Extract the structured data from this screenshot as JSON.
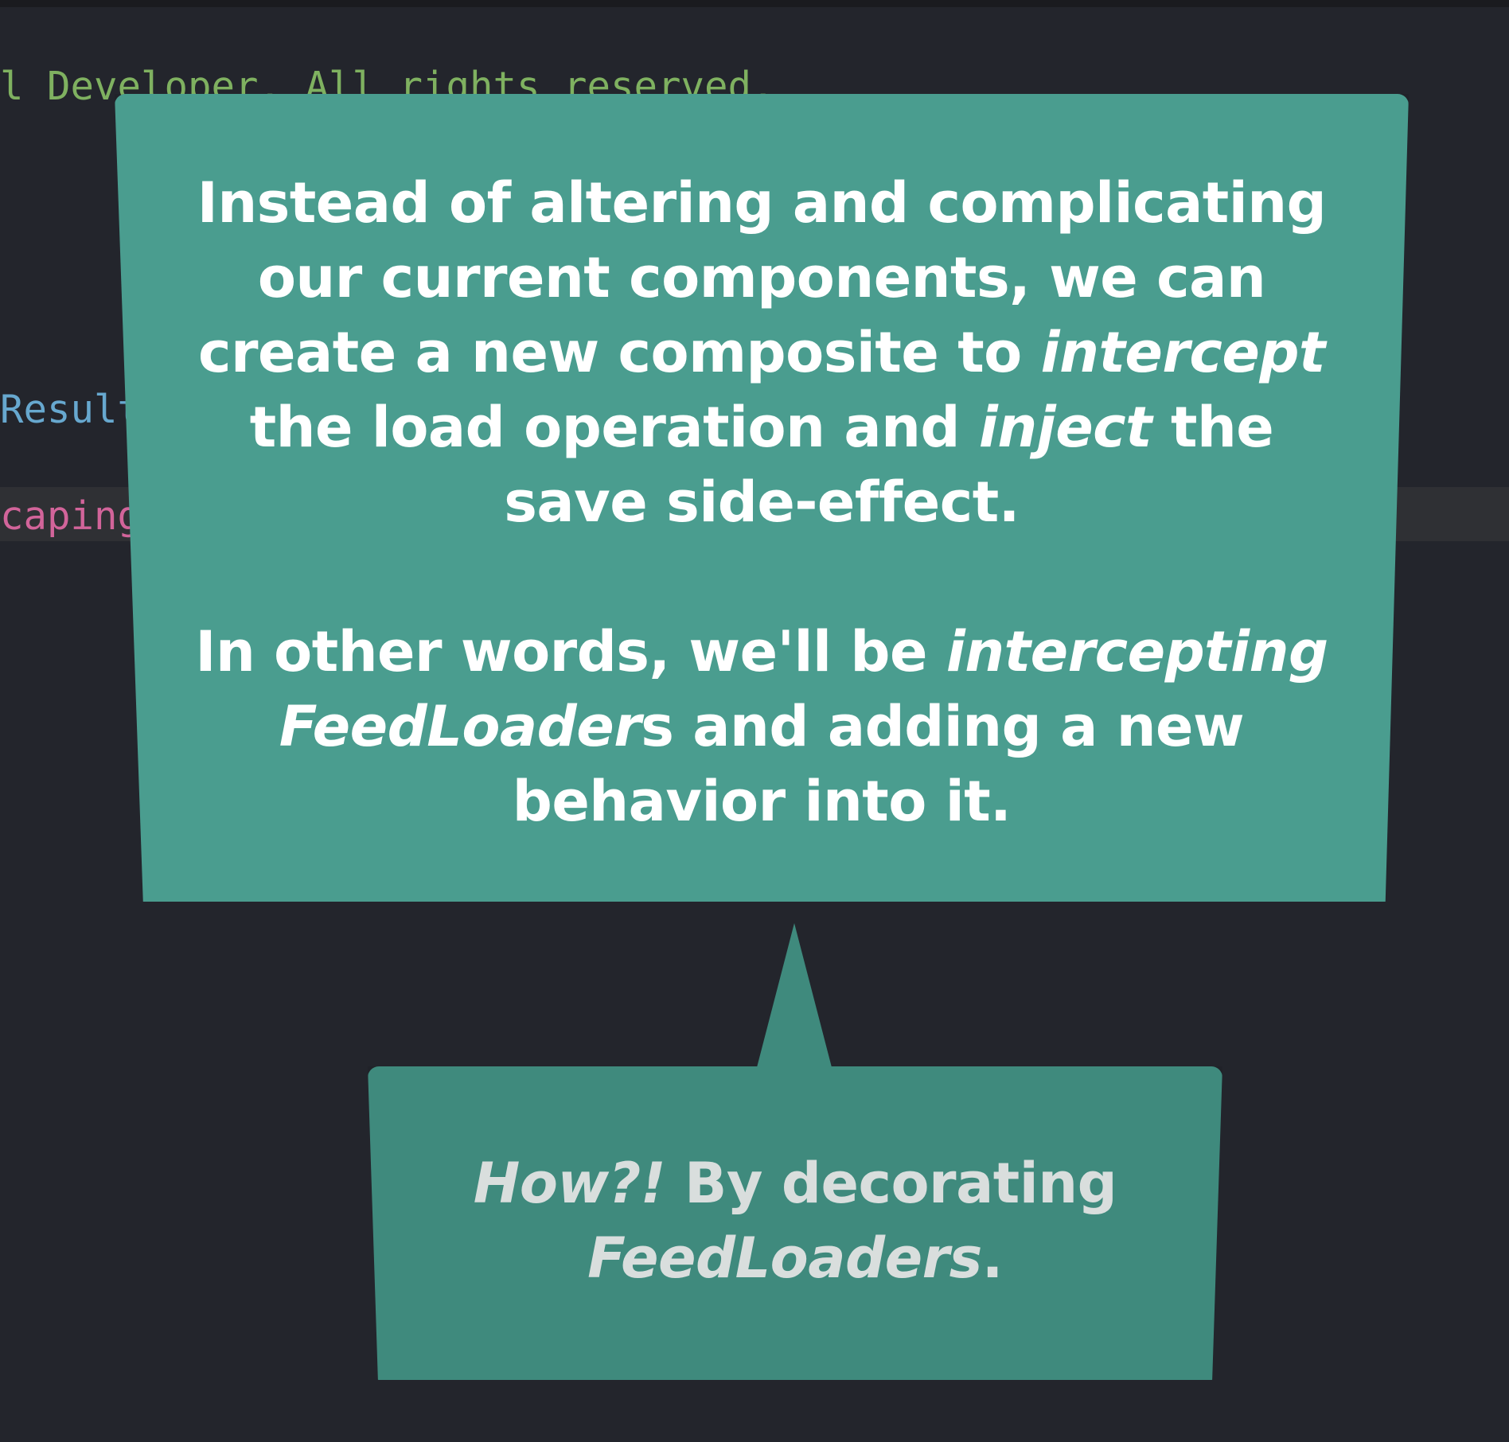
{
  "background": {
    "code_comment": "l Developer. All rights reserved.",
    "code_type": "Result",
    "code_keyword": "caping"
  },
  "main_card": {
    "p1": {
      "line1": "Instead of altering and complicating",
      "line2": "our current components, we can",
      "line3_pre": "create a new composite to ",
      "line3_em": "intercept",
      "line4_pre": "the load operation and ",
      "line4_em": "inject",
      "line4_post": " the",
      "line5": "save side-effect."
    },
    "p2": {
      "line1_pre": "In other words, we'll be ",
      "line1_em": "intercepting",
      "line2_em": "FeedLoader",
      "line2_post": "s and adding a new",
      "line3": "behavior into it."
    }
  },
  "sub_card": {
    "line1_em": "How?!",
    "line1_post": " By decorating",
    "line2_em": "FeedLoaders",
    "line2_post": "."
  },
  "colors": {
    "background": "#23252c",
    "card": "#4a9d8f",
    "sub_card": "#3f8a7d",
    "code_comment": "#7fb160",
    "code_type": "#67a8cf",
    "code_keyword": "#d2649a"
  }
}
